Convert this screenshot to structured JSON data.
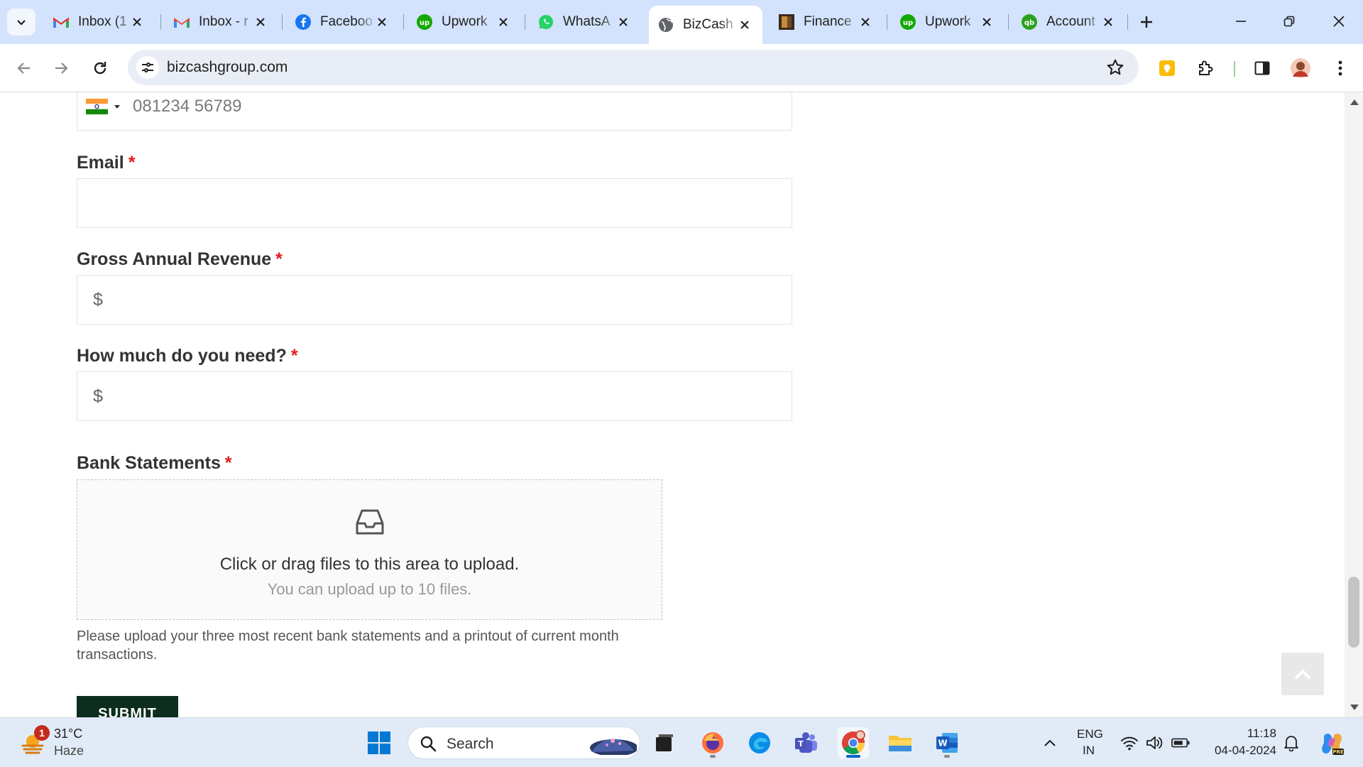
{
  "browser": {
    "tabs": [
      {
        "title": "Inbox (1",
        "icon": "gmail-icon"
      },
      {
        "title": "Inbox - r",
        "icon": "gmail-icon"
      },
      {
        "title": "Faceboo",
        "icon": "facebook-icon"
      },
      {
        "title": "Upwork",
        "icon": "upwork-icon"
      },
      {
        "title": "WhatsA",
        "icon": "whatsapp-icon"
      },
      {
        "title": "BizCash",
        "icon": "globe-icon",
        "active": true
      },
      {
        "title": "Finance",
        "icon": "finance-icon"
      },
      {
        "title": "Upwork",
        "icon": "upwork-icon"
      },
      {
        "title": "Account",
        "icon": "quickbooks-icon"
      }
    ],
    "url": "bizcashgroup.com"
  },
  "form": {
    "phone_placeholder": "081234 56789",
    "email_label": "Email",
    "revenue_label": "Gross Annual Revenue",
    "amount_label": "How much do you need?",
    "currency_prefix": "$",
    "required_marker": "*",
    "bank_label": "Bank Statements",
    "upload_main": "Click or drag files to this area to upload.",
    "upload_hint": "You can upload up to 10 files.",
    "help_text": "Please upload your three most recent bank statements and a printout of current month transactions.",
    "submit_label": "SUBMIT"
  },
  "taskbar": {
    "weather_badge": "1",
    "weather_temp": "31°C",
    "weather_desc": "Haze",
    "search_label": "Search",
    "lang_line1": "ENG",
    "lang_line2": "IN",
    "time": "11:18",
    "date": "04-04-2024"
  },
  "colors": {
    "tabbar_bg": "#d3e3fd",
    "required": "#e31b1b",
    "submit_bg": "#0b2e1f",
    "taskbar_bg": "#e1ebf8"
  }
}
